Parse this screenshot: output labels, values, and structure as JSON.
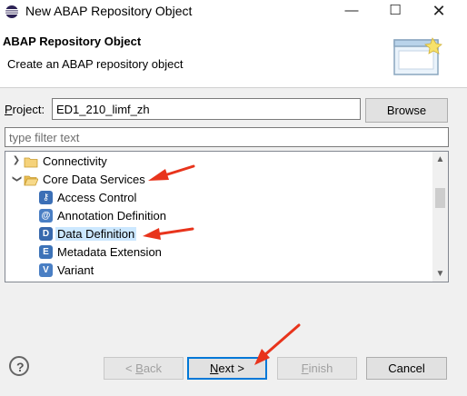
{
  "window": {
    "title": "New ABAP Repository Object",
    "minimize_glyph": "—",
    "maximize_glyph": "☐",
    "close_glyph": "✕"
  },
  "header": {
    "title": "ABAP Repository Object",
    "description": "Create an ABAP repository object"
  },
  "project": {
    "label_mnemonic": "P",
    "label_rest": "roject:",
    "value": "ED1_210_limf_zh",
    "browse_label": "Browse"
  },
  "filter": {
    "placeholder": "type filter text",
    "value": ""
  },
  "tree": {
    "items": [
      {
        "label": "Connectivity",
        "type": "folder",
        "expanded": false
      },
      {
        "label": "Core Data Services",
        "type": "folder",
        "expanded": true
      },
      {
        "label": "Access Control",
        "type": "object",
        "icon": "access-control-icon",
        "icon_glyph": "⚷"
      },
      {
        "label": "Annotation Definition",
        "type": "object",
        "icon": "annotation-definition-icon",
        "icon_glyph": "@"
      },
      {
        "label": "Data Definition",
        "type": "object",
        "icon": "data-definition-icon",
        "icon_glyph": "D",
        "selected": true
      },
      {
        "label": "Metadata Extension",
        "type": "object",
        "icon": "metadata-extension-icon",
        "icon_glyph": "E"
      },
      {
        "label": "Variant",
        "type": "object",
        "icon": "variant-icon",
        "icon_glyph": "V"
      }
    ]
  },
  "buttons": {
    "help_glyph": "?",
    "back_prefix": "< ",
    "back_mnemonic": "B",
    "back_rest": "ack",
    "next_mnemonic": "N",
    "next_rest": "ext >",
    "finish_mnemonic": "F",
    "finish_rest": "inish",
    "cancel_label": "Cancel"
  },
  "colors": {
    "selection": "#cce8ff",
    "accent": "#0078d7",
    "annotation_arrow": "#e8341c"
  }
}
